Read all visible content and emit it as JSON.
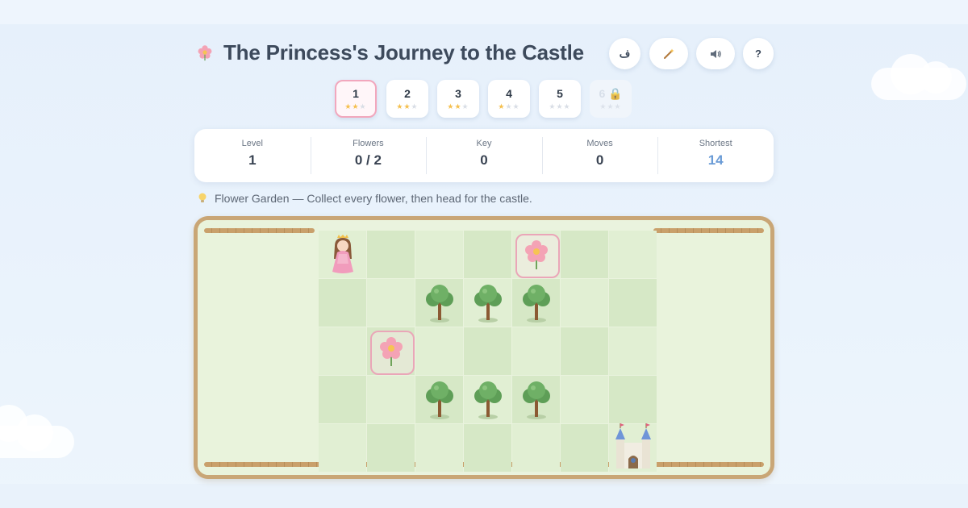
{
  "title": "The Princess's Journey to the Castle",
  "controls": {
    "language_label": "ف",
    "wand_icon": "wand-icon",
    "sound_icon": "speaker-icon",
    "help_label": "?"
  },
  "levels": [
    {
      "label": "1",
      "stars": 2,
      "state": "active"
    },
    {
      "label": "2",
      "stars": 2,
      "state": "unlocked"
    },
    {
      "label": "3",
      "stars": 2,
      "state": "unlocked"
    },
    {
      "label": "4",
      "stars": 1,
      "state": "unlocked"
    },
    {
      "label": "5",
      "stars": 0,
      "state": "unlocked"
    },
    {
      "label": "6 🔒",
      "stars": 0,
      "state": "locked"
    }
  ],
  "stats": {
    "level": {
      "label": "Level",
      "value": "1"
    },
    "flowers": {
      "label": "Flowers",
      "value": "0 / 2"
    },
    "key": {
      "label": "Key",
      "value": "0"
    },
    "moves": {
      "label": "Moves",
      "value": "0"
    },
    "shortest": {
      "label": "Shortest",
      "value": "14"
    }
  },
  "hint": "Flower Garden — Collect every flower, then head for the castle.",
  "board": {
    "cols": 7,
    "rows": 5,
    "cells": [
      [
        "princess",
        "",
        "",
        "",
        "flower",
        "",
        ""
      ],
      [
        "",
        "",
        "tree",
        "tree",
        "tree",
        "",
        ""
      ],
      [
        "",
        "flower",
        "",
        "",
        "",
        "",
        ""
      ],
      [
        "",
        "",
        "tree",
        "tree",
        "tree",
        "",
        ""
      ],
      [
        "",
        "",
        "",
        "",
        "",
        "",
        "castle"
      ]
    ]
  },
  "colors": {
    "accent_pink": "#f2a7bd",
    "highlight_blue": "#6a9bd6",
    "star_gold": "#f5c04f",
    "board_frame": "#c9a676"
  }
}
